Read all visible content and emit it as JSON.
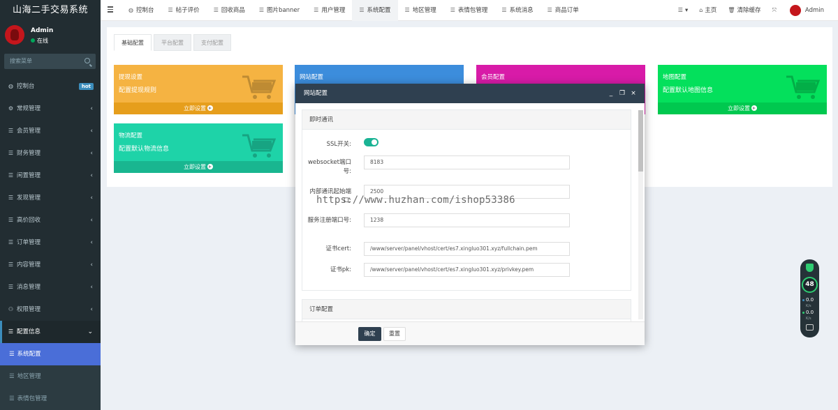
{
  "app": {
    "title": "山海二手交易系统"
  },
  "user": {
    "name": "Admin",
    "status": "在线"
  },
  "sidebar": {
    "search_placeholder": "搜索菜单",
    "items": [
      {
        "label": "控制台",
        "icon": "dashboard-icon",
        "badge": "hot"
      },
      {
        "label": "常规管理",
        "icon": "gears-icon"
      },
      {
        "label": "会员管理",
        "icon": "list-icon"
      },
      {
        "label": "财务管理",
        "icon": "list-icon"
      },
      {
        "label": "闲置管理",
        "icon": "list-icon"
      },
      {
        "label": "发现管理",
        "icon": "list-icon"
      },
      {
        "label": "高价回收",
        "icon": "list-icon"
      },
      {
        "label": "订单管理",
        "icon": "list-icon"
      },
      {
        "label": "内容管理",
        "icon": "list-icon"
      },
      {
        "label": "消息管理",
        "icon": "list-icon"
      },
      {
        "label": "权限管理",
        "icon": "users-icon"
      },
      {
        "label": "配置信息",
        "icon": "list-icon"
      }
    ],
    "subitems": [
      {
        "label": "系统配置"
      },
      {
        "label": "地区管理"
      },
      {
        "label": "表情包管理"
      }
    ]
  },
  "topnav": {
    "tabs": [
      {
        "label": "控制台",
        "icon": "dashboard-icon"
      },
      {
        "label": "帖子评价",
        "icon": "list-icon"
      },
      {
        "label": "回收商品",
        "icon": "list-icon"
      },
      {
        "label": "图片banner",
        "icon": "list-icon"
      },
      {
        "label": "用户管理",
        "icon": "list-icon"
      },
      {
        "label": "系统配置",
        "icon": "list-icon"
      },
      {
        "label": "地区管理",
        "icon": "list-icon"
      },
      {
        "label": "表情包管理",
        "icon": "list-icon"
      },
      {
        "label": "系统消息",
        "icon": "list-icon"
      },
      {
        "label": "商品订单",
        "icon": "list-icon"
      }
    ],
    "right": {
      "home": "主页",
      "clear_cache": "清除缓存",
      "user": "Admin"
    }
  },
  "config_tabs": [
    "基础配置",
    "平台配置",
    "支付配置"
  ],
  "cards": [
    {
      "title": "提现设置",
      "desc": "配置提现规则",
      "footer": "立即设置",
      "color": "#f39c12",
      "foot_color": "#e08e0b"
    },
    {
      "title": "网站配置",
      "desc": "",
      "footer": "",
      "color": "#3c8dbc",
      "foot_color": "#367fa9"
    },
    {
      "title": "会员配置",
      "desc": "",
      "footer": "",
      "color": "#d81b9b",
      "foot_color": "#c21a8c"
    },
    {
      "title": "地图配置",
      "desc": "配置默认地图信息",
      "footer": "立即设置",
      "color": "#00e052",
      "foot_color": "#00c548"
    },
    {
      "title": "物流配置",
      "desc": "配置默认物流信息",
      "footer": "立即设置",
      "color": "#1ec8a0",
      "foot_color": "#18b18e"
    }
  ],
  "modal": {
    "title": "网站配置",
    "section1": {
      "title": "即时通讯",
      "ssl_label": "SSL开关:",
      "ssl_on": true,
      "ws_port_label": "websocket端口号:",
      "ws_port": "8183",
      "internal_port_label": "内部通讯起始端口:",
      "internal_port": "2500",
      "register_port_label": "服务注册端口号:",
      "register_port": "1238",
      "cert_label": "证书cert:",
      "cert": "/www/server/panel/vhost/cert/es7.xingluo301.xyz/fullchain.pem",
      "pk_label": "证书pk:",
      "pk": "/www/server/panel/vhost/cert/es7.xingluo301.xyz/privkey.pem"
    },
    "section2": {
      "title": "订单配置"
    },
    "ok": "确定",
    "reset": "重置"
  },
  "watermark": "https://www.huzhan.com/ishop53386",
  "widget": {
    "score": "48",
    "up": "0.0",
    "up_unit": "K/s",
    "down": "0.0",
    "down_unit": "K/s"
  }
}
